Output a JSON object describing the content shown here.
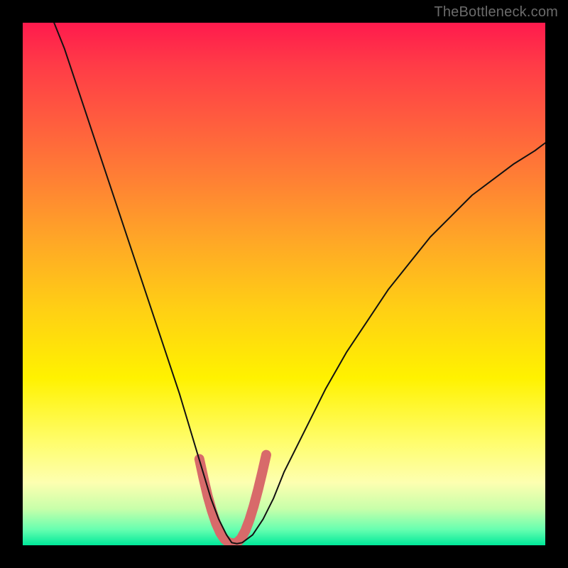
{
  "watermark": "TheBottleneck.com",
  "chart_data": {
    "type": "line",
    "title": "",
    "xlabel": "",
    "ylabel": "",
    "xlim": [
      0,
      100
    ],
    "ylim": [
      0,
      100
    ],
    "series": [
      {
        "name": "bottleneck-curve",
        "x": [
          6,
          8,
          10,
          12,
          14,
          16,
          18,
          20,
          22,
          24,
          26,
          28,
          30,
          31.5,
          33,
          34.5,
          36,
          37.5,
          39,
          40,
          41,
          42,
          44,
          46,
          48,
          50,
          54,
          58,
          62,
          66,
          70,
          74,
          78,
          82,
          86,
          90,
          94,
          98,
          100
        ],
        "y": [
          100,
          95,
          89,
          83,
          77,
          71,
          65,
          59,
          53,
          47,
          41,
          35,
          29,
          24,
          19,
          14,
          9,
          5,
          2,
          0.5,
          0.3,
          0.5,
          2,
          5,
          9,
          14,
          22,
          30,
          37,
          43,
          49,
          54,
          59,
          63,
          67,
          70,
          73,
          75.5,
          77
        ],
        "color": "#111111",
        "width": 2
      },
      {
        "name": "optimal-zone-overlay",
        "x": [
          33.8,
          34.6,
          35.4,
          36.2,
          37.0,
          37.8,
          38.6,
          39.4,
          40.2,
          41.0,
          41.8,
          42.6,
          43.4,
          44.2,
          45.0,
          45.8,
          46.6
        ],
        "y": [
          16.5,
          12.8,
          9.4,
          6.6,
          4.2,
          2.4,
          1.2,
          0.55,
          0.35,
          0.5,
          1.3,
          2.8,
          4.9,
          7.5,
          10.5,
          13.8,
          17.3
        ],
        "color": "#d86a6a",
        "width": 14
      }
    ]
  }
}
